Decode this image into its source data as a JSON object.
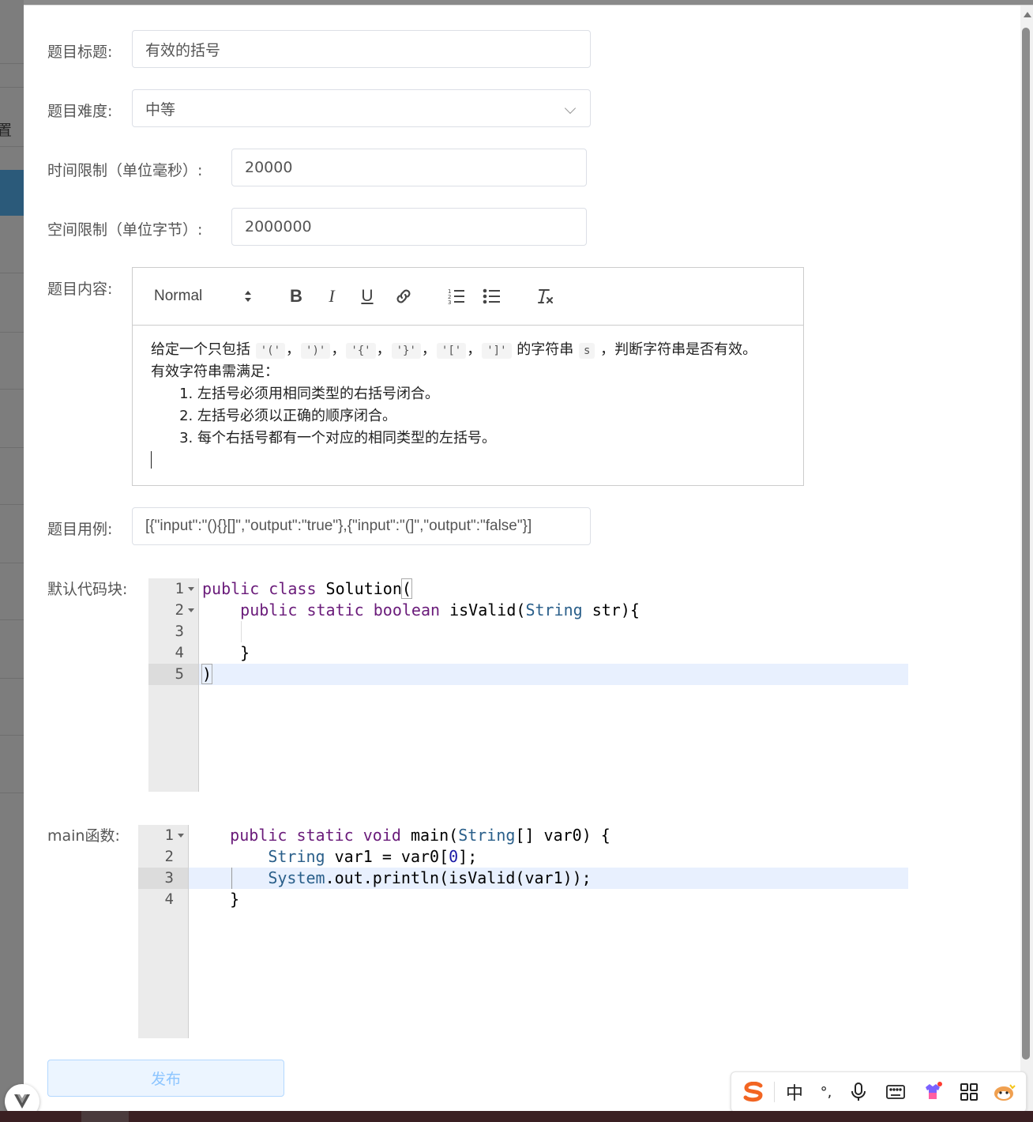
{
  "background": {
    "side_char": "置"
  },
  "form": {
    "title_label": "题目标题:",
    "title_value": "有效的括号",
    "difficulty_label": "题目难度:",
    "difficulty_value": "中等",
    "time_label": "时间限制（单位毫秒）:",
    "time_value": "20000",
    "space_label": "空间限制（单位字节）:",
    "space_value": "2000000",
    "content_label": "题目内容:",
    "cases_label": "题目用例:",
    "cases_value": "[{\"input\":\"(){}[]\",\"output\":\"true\"},{\"input\":\"(]\",\"output\":\"false\"}]",
    "code_label": "默认代码块:",
    "main_label": "main函数:",
    "publish_label": "发布"
  },
  "editor": {
    "toolbar": {
      "header_select": "Normal",
      "bold": "B",
      "italic": "I",
      "underline": "U"
    },
    "paragraph1_pre": "给定一个只包括 ",
    "chips": [
      "'('",
      "')'",
      "'{'",
      "'}'",
      "'['",
      "']'"
    ],
    "sep": "，",
    "paragraph1_mid": " 的字符串 ",
    "chip_s": "s",
    "paragraph1_post": " ，判断字符串是否有效。",
    "paragraph2": "有效字符串需满足：",
    "rules": [
      "左括号必须用相同类型的右括号闭合。",
      "左括号必须以正确的顺序闭合。",
      "每个右括号都有一个对应的相同类型的左括号。"
    ]
  },
  "default_code": {
    "line_numbers": [
      "1",
      "2",
      "3",
      "4",
      "5"
    ],
    "lines": [
      "public class Solution(",
      "    public static boolean isValid(String str){",
      "",
      "    }",
      ")"
    ]
  },
  "main_code": {
    "line_numbers": [
      "1",
      "2",
      "3",
      "4"
    ],
    "lines": [
      "    public static void main(String[] var0) {",
      "        String var1 = var0[0];",
      "        System.out.println(isValid(var1));",
      "    }"
    ]
  },
  "ime": {
    "mode": "中",
    "punct": "°,"
  }
}
